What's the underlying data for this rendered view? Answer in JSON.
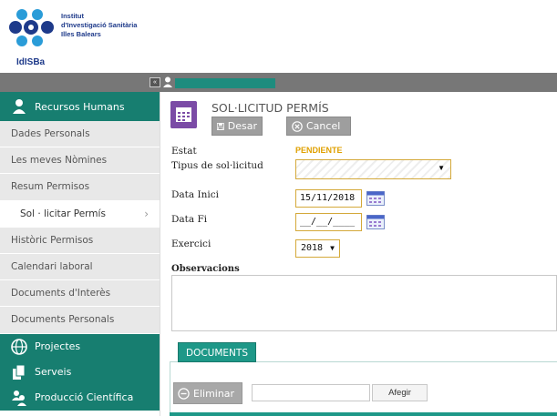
{
  "org": {
    "name_lines": [
      "Institut",
      "d'Investigació Sanitària",
      "Illes Balears"
    ],
    "abbr": "IdISBa"
  },
  "topbar": {
    "collapse_glyph": "«"
  },
  "sidebar": {
    "sections": [
      {
        "label": "Recursos Humans",
        "icon": "person-icon"
      },
      {
        "label": "Projectes",
        "icon": "globe-icon"
      },
      {
        "label": "Serveis",
        "icon": "documents-icon"
      },
      {
        "label": "Producció Científica",
        "icon": "people-icon"
      }
    ],
    "items": [
      {
        "label": "Dades Personals"
      },
      {
        "label": "Les meves Nòmines"
      },
      {
        "label": "Resum Permisos"
      },
      {
        "label": "Sol · licitar Permís",
        "active": true
      },
      {
        "label": "Històric Permisos"
      },
      {
        "label": "Calendari laboral"
      },
      {
        "label": "Documents d'Interès"
      },
      {
        "label": "Documents Personals"
      }
    ],
    "active_chevron": "›"
  },
  "main": {
    "title": "SOL·LICITUD PERMÍS",
    "buttons": {
      "save": "Desar",
      "cancel": "Cancel"
    },
    "form": {
      "estat_label": "Estat",
      "estat_value": "PENDIENTE",
      "tipus_label": "Tipus de sol·licitud",
      "tipus_value": "",
      "data_inici_label": "Data Inici",
      "data_inici_value": "15/11/2018",
      "data_fi_label": "Data Fi",
      "data_fi_value": "__/__/____",
      "exercici_label": "Exercici",
      "exercici_value": "2018",
      "observacions_label": "Observacions",
      "observacions_value": ""
    },
    "documents": {
      "tab_label": "DOCUMENTS",
      "delete_label": "Eliminar",
      "add_label": "Afegir"
    }
  },
  "colors": {
    "teal": "#177e70",
    "status": "#e0a000",
    "purple_icon": "#7b4ba6"
  }
}
